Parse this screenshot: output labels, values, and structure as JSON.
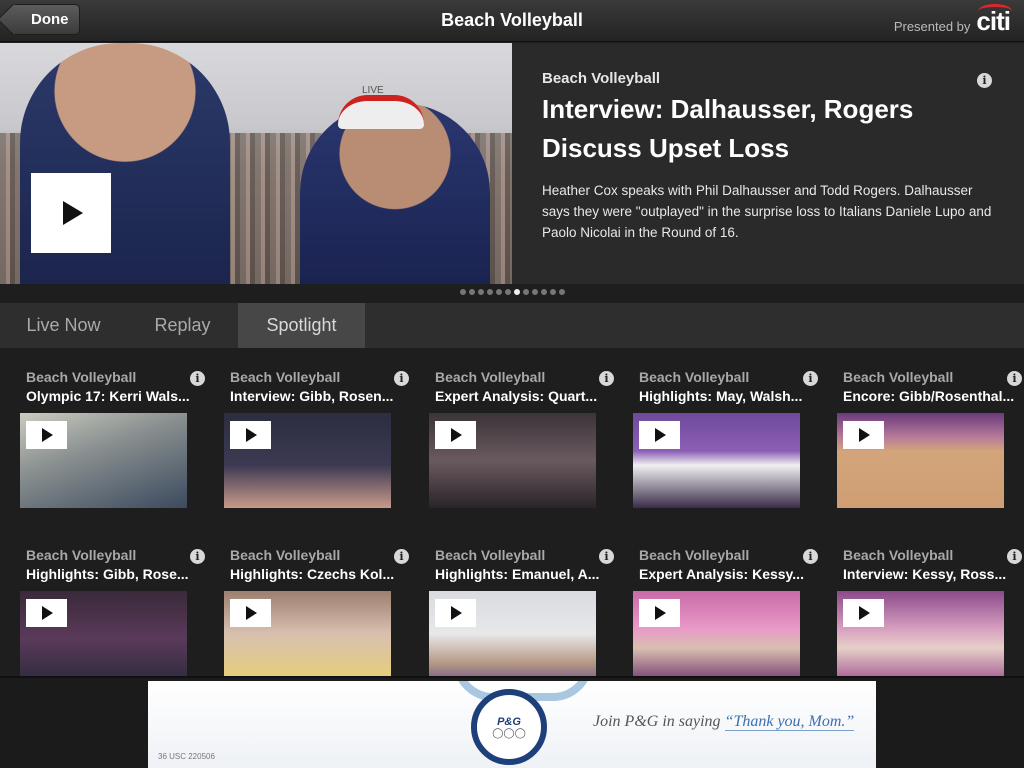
{
  "topbar": {
    "done_label": "Done",
    "title": "Beach Volleyball",
    "presented_by": "Presented by",
    "sponsor": "citi"
  },
  "hero": {
    "overlay_tag": "LIVE",
    "category": "Beach Volleyball",
    "title": "Interview: Dalhausser, Rogers Discuss Upset Loss",
    "description": "Heather Cox speaks with Phil Dalhausser and Todd Rogers. Dalhausser says they were \"outplayed\" in the surprise loss to Italians Daniele Lupo and Paolo Nicolai in the Round of 16.",
    "info_icon": "info-icon",
    "play_icon": "play-icon"
  },
  "pager": {
    "total": 12,
    "active": 6
  },
  "tabs": [
    {
      "label": "Live Now",
      "active": false
    },
    {
      "label": "Replay",
      "active": false
    },
    {
      "label": "Spotlight",
      "active": true
    }
  ],
  "videos": [
    {
      "category": "Beach Volleyball",
      "title": "Olympic 17: Kerri Wals..."
    },
    {
      "category": "Beach Volleyball",
      "title": "Interview: Gibb, Rosen..."
    },
    {
      "category": "Beach Volleyball",
      "title": "Expert Analysis: Quart..."
    },
    {
      "category": "Beach Volleyball",
      "title": "Highlights: May, Walsh..."
    },
    {
      "category": "Beach Volleyball",
      "title": "Encore: Gibb/Rosenthal..."
    },
    {
      "category": "Beach Volleyball",
      "title": "Highlights: Gibb, Rose..."
    },
    {
      "category": "Beach Volleyball",
      "title": "Highlights: Czechs Kol..."
    },
    {
      "category": "Beach Volleyball",
      "title": "Highlights: Emanuel, A..."
    },
    {
      "category": "Beach Volleyball",
      "title": "Expert Analysis: Kessy..."
    },
    {
      "category": "Beach Volleyball",
      "title": "Interview: Kessy, Ross..."
    }
  ],
  "ad": {
    "brand": "P&G",
    "slogan_prefix": "Join P&G in saying",
    "slogan_highlight": "“Thank you, Mom.”",
    "legal": "36 USC 220506"
  },
  "colors": {
    "accent_red": "#d9262f",
    "ad_blue": "#1d3f7a"
  }
}
